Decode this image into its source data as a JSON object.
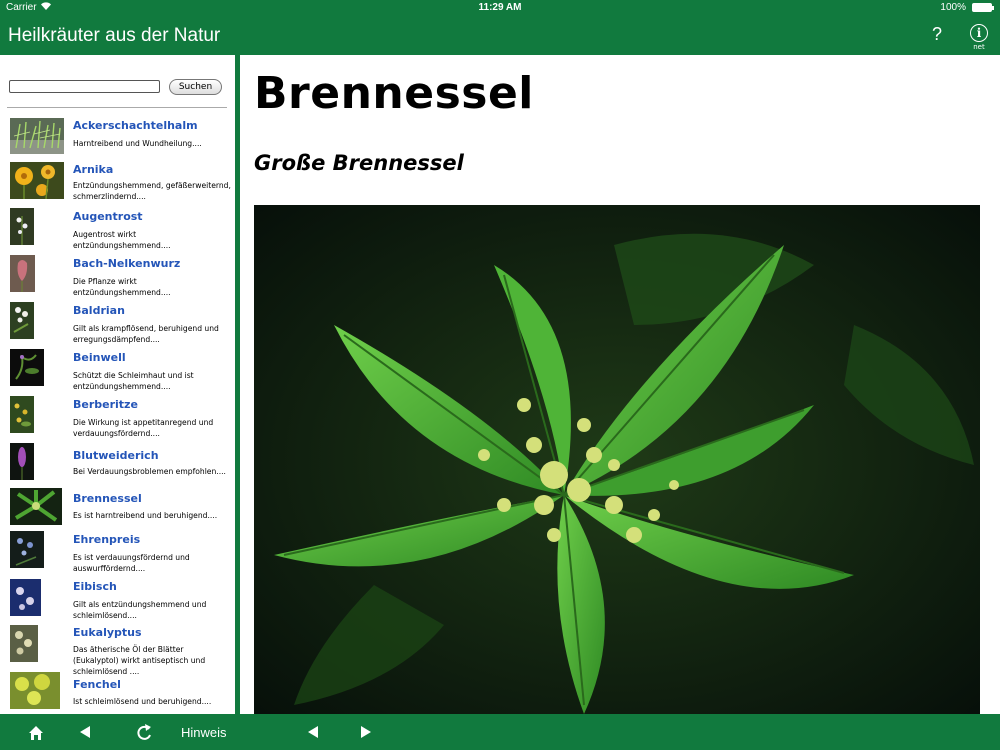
{
  "status": {
    "carrier": "Carrier",
    "time": "11:29 AM",
    "battery": "100%"
  },
  "header": {
    "title": "Heilkräuter aus der Natur",
    "help": "?",
    "info_glyph": "i",
    "info_label": "net"
  },
  "search": {
    "value": "",
    "placeholder": "",
    "button": "Suchen"
  },
  "plants": [
    {
      "name": "Ackerschachtelhalm",
      "desc": "Harntreibend und Wundheilung...."
    },
    {
      "name": "Arnika",
      "desc": "Entzündungshemmend, gefäßerweiternd, schmerzlindernd...."
    },
    {
      "name": "Augentrost",
      "desc": "Augentrost wirkt entzündungshemmend...."
    },
    {
      "name": "Bach-Nelkenwurz",
      "desc": "Die Pflanze wirkt entzündungshemmend...."
    },
    {
      "name": "Baldrian",
      "desc": "Gilt als krampflösend, beruhigend und erregungsdämpfend...."
    },
    {
      "name": "Beinwell",
      "desc": "Schützt die Schleimhaut und ist entzündungshemmend...."
    },
    {
      "name": "Berberitze",
      "desc": "Die Wirkung ist appetitanregend und verdauungsfördernd...."
    },
    {
      "name": "Blutweiderich",
      "desc": "Bei Verdauungsbroblemen empfohlen...."
    },
    {
      "name": "Brennessel",
      "desc": "Es ist harntreibend und beruhigend...."
    },
    {
      "name": "Ehrenpreis",
      "desc": "Es ist verdauungsfördernd und auswurffördernd...."
    },
    {
      "name": "Eibisch",
      "desc": "Gilt als entzündungshemmend und schleimlösend...."
    },
    {
      "name": "Eukalyptus",
      "desc": "Das ätherische Öl der Blätter (Eukalyptol) wirkt antiseptisch und schleimlösend ...."
    },
    {
      "name": "Fenchel",
      "desc": "Ist schleimlösend und beruhigend...."
    }
  ],
  "detail": {
    "title": "Brennessel",
    "subtitle": "Große Brennessel"
  },
  "toolbar": {
    "hint": "Hinweis"
  },
  "colors": {
    "brand_green": "#117a3e",
    "link_blue": "#2455b8"
  }
}
